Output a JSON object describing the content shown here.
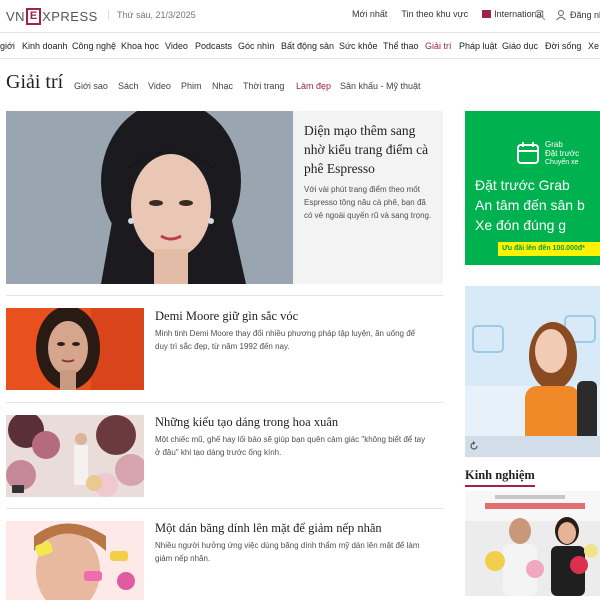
{
  "header": {
    "logo_left": "VN",
    "logo_e": "E",
    "logo_right": "XPRESS",
    "date": "Thứ sáu, 21/3/2025",
    "latest": "Mới nhất",
    "local_news": "Tin theo khu vực",
    "international": "International",
    "login": "Đăng nh"
  },
  "mainnav": [
    {
      "label": "giới",
      "active": false
    },
    {
      "label": "Kinh doanh",
      "active": false
    },
    {
      "label": "Công nghệ",
      "active": false
    },
    {
      "label": "Khoa học",
      "active": false
    },
    {
      "label": "Video",
      "active": false
    },
    {
      "label": "Podcasts",
      "active": false
    },
    {
      "label": "Góc nhìn",
      "active": false
    },
    {
      "label": "Bất động sản",
      "active": false
    },
    {
      "label": "Sức khỏe",
      "active": false
    },
    {
      "label": "Thể thao",
      "active": false
    },
    {
      "label": "Giải trí",
      "active": true
    },
    {
      "label": "Pháp luật",
      "active": false
    },
    {
      "label": "Giáo dục",
      "active": false
    },
    {
      "label": "Đời sống",
      "active": false
    },
    {
      "label": "Xe",
      "active": false
    }
  ],
  "category": {
    "title": "Giải trí",
    "subnav": [
      {
        "label": "Giới sao",
        "active": false
      },
      {
        "label": "Sách",
        "active": false
      },
      {
        "label": "Video",
        "active": false
      },
      {
        "label": "Phim",
        "active": false
      },
      {
        "label": "Nhạc",
        "active": false
      },
      {
        "label": "Thời trang",
        "active": false
      },
      {
        "label": "Làm đẹp",
        "active": true
      },
      {
        "label": "Sân khấu - Mỹ thuật",
        "active": false
      }
    ]
  },
  "featured": {
    "title": "Diện mạo thêm sang nhờ kiểu trang điểm cà phê Espresso",
    "desc": "Với vài phút trang điểm theo mốt Espresso tông nâu cà phê, bạn đã có vẻ ngoài quyến rũ và sang trọng."
  },
  "articles": [
    {
      "title": "Demi Moore giữ gìn sắc vóc",
      "desc": "Minh tinh Demi Moore thay đổi nhiều phương pháp tập luyện, ăn uống để duy trì sắc đẹp, từ năm 1992 đến nay."
    },
    {
      "title": "Những kiểu tạo dáng trong hoa xuân",
      "desc": "Một chiếc mũ, ghế hay lối bảo sẽ giúp bạn quên cảm giác \"không biết để tay ở đâu\" khi tạo dáng trước ống kính."
    },
    {
      "title": "Một dán băng dính lên mặt để giảm nếp nhăn",
      "desc": "Nhiều người hưởng ứng việc dùng băng dính thẩm mỹ dán lên mặt để làm giảm nếp nhăn."
    }
  ],
  "ad": {
    "brand": "Grab",
    "brand_sub1": "Đặt trước",
    "brand_sub2": "Chuyến xe",
    "line1": "Đặt trước Grab",
    "line2": "An tâm đến sân b",
    "line3": "Xe đón đúng g",
    "cta": "Ưu đãi lên đến 100.000đ*"
  },
  "sidebar": {
    "section_title": "Kinh nghiệm"
  },
  "colors": {
    "brand": "#9f224e",
    "grab_green": "#00b14f"
  }
}
